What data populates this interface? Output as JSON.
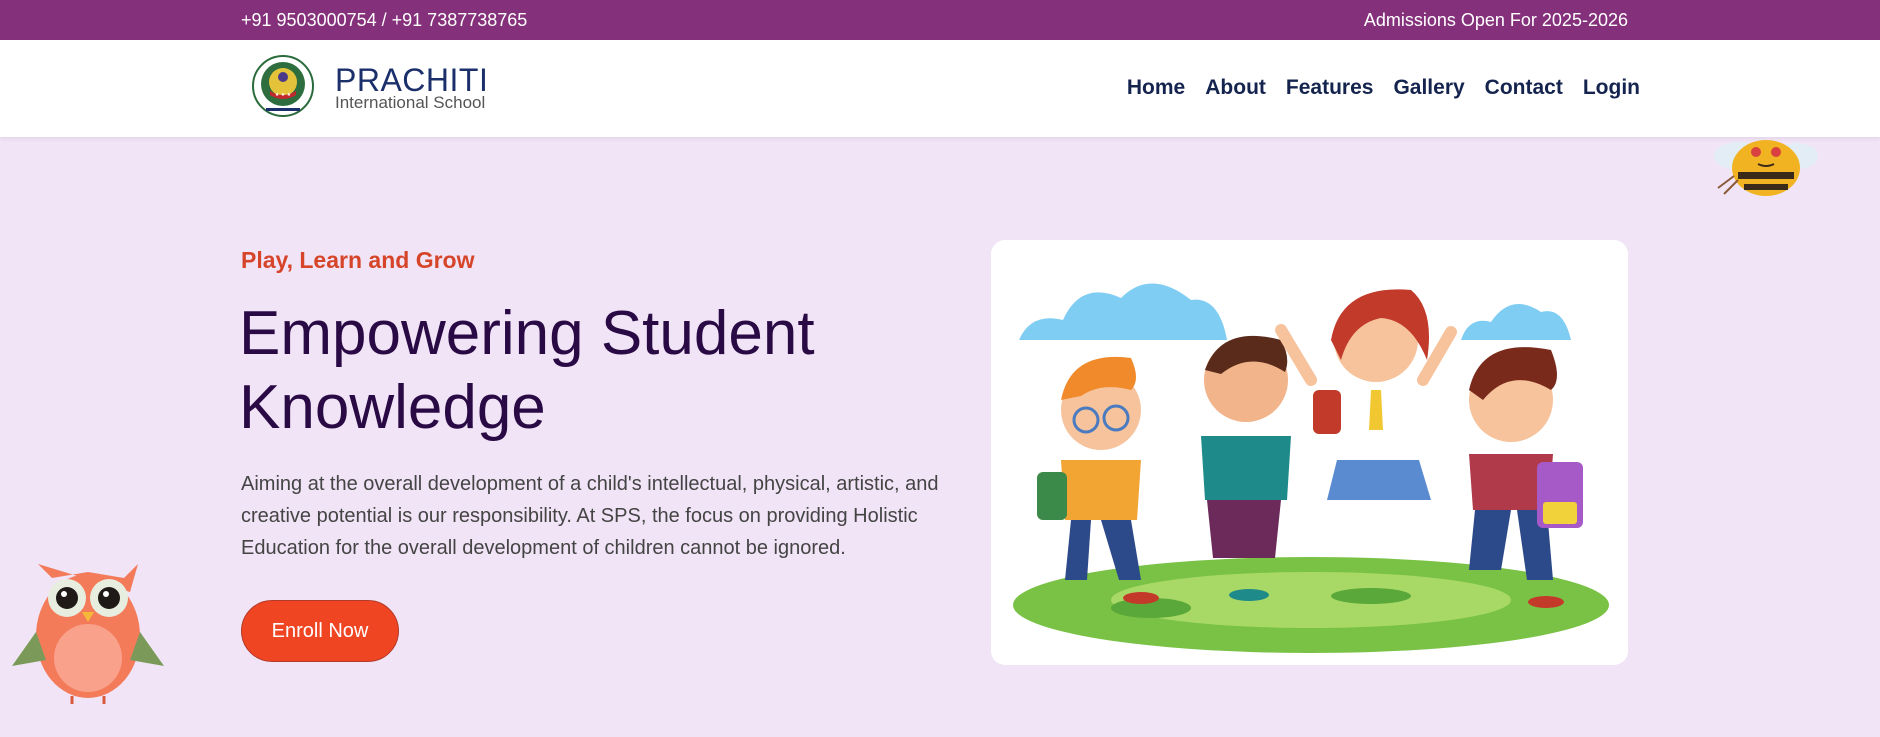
{
  "topbar": {
    "phone": "+91 9503000754 / +91 7387738765",
    "admissions": "Admissions Open For 2025-2026"
  },
  "header": {
    "brand_name": "PRACHITI",
    "brand_sub": "International School",
    "nav": [
      "Home",
      "About",
      "Features",
      "Gallery",
      "Contact",
      "Login"
    ]
  },
  "hero": {
    "eyebrow": "Play, Learn and Grow",
    "title": "Empowering Student Knowledge",
    "text": "Aiming at the overall development of a child's intellectual, physical, artistic, and creative potential is our responsibility. At SPS, the focus on providing Holistic Education for the overall development of children cannot be ignored.",
    "cta": "Enroll Now"
  },
  "colors": {
    "topbar": "#85307b",
    "page_bg": "#f0e4f6",
    "accent": "#ef4523",
    "heading": "#2a0a45",
    "nav": "#15244f"
  },
  "icons": [
    "school-logo-icon",
    "bee-icon",
    "owl-icon",
    "kids-illustration"
  ]
}
